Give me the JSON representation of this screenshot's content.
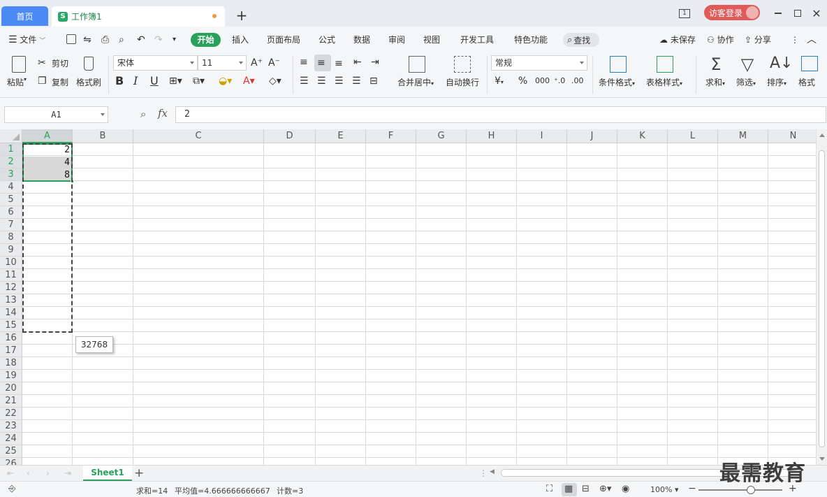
{
  "titlebar": {
    "home_tab": "首页",
    "doc_tab": "工作簿1",
    "doc_icon": "S",
    "new_tab": "+",
    "page_indicator": "1",
    "guest_login": "访客登录"
  },
  "menubar": {
    "file": "文件",
    "tabs": [
      "开始",
      "插入",
      "页面布局",
      "公式",
      "数据",
      "审阅",
      "视图",
      "开发工具",
      "特色功能"
    ],
    "search": "查找",
    "unsaved": "未保存",
    "collaborate": "协作",
    "share": "分享"
  },
  "ribbon": {
    "paste": "粘贴",
    "cut": "剪切",
    "copy": "复制",
    "format_painter": "格式刷",
    "font_name": "宋体",
    "font_size": "11",
    "bold": "B",
    "italic": "I",
    "underline": "U",
    "merge_center": "合并居中",
    "wrap_text": "自动换行",
    "number_format": "常规",
    "currency": "¥",
    "percent": "%",
    "thousands": "000",
    "conditional_format": "条件格式",
    "table_style": "表格样式",
    "sum": "求和",
    "filter": "筛选",
    "sort": "排序",
    "format": "格式"
  },
  "formulabar": {
    "name_box": "A1",
    "fx": "fx",
    "formula": "2"
  },
  "grid": {
    "columns": [
      "A",
      "B",
      "C",
      "D",
      "E",
      "F",
      "G",
      "H",
      "I",
      "J",
      "K",
      "L",
      "M",
      "N"
    ],
    "rows": [
      "1",
      "2",
      "3",
      "4",
      "5",
      "6",
      "7",
      "8",
      "9",
      "10",
      "11",
      "12",
      "13",
      "14",
      "15",
      "16",
      "17",
      "18",
      "19",
      "20",
      "21",
      "22",
      "23",
      "24",
      "25",
      "26"
    ],
    "cells": {
      "A1": "2",
      "A2": "4",
      "A3": "8"
    },
    "tooltip": "32768"
  },
  "sheets": {
    "active": "Sheet1",
    "add": "+"
  },
  "status": {
    "sum": "求和=14",
    "average": "平均值=4.666666666667",
    "count": "计数=3",
    "zoom": "100%"
  },
  "watermark": "最需教育",
  "colors": {
    "accent": "#2aa15b",
    "home_tab": "#4c8bf5",
    "guest_button": "#e15a5a"
  }
}
